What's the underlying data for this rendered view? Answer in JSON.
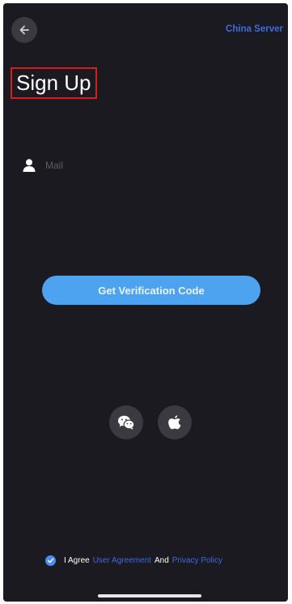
{
  "header": {
    "back_icon": "arrow-left-icon",
    "server_link": "China Server"
  },
  "title": "Sign Up",
  "mail_field": {
    "icon": "user-icon",
    "placeholder": "Mail",
    "value": ""
  },
  "verify_button": {
    "label": "Get Verification Code"
  },
  "social_login": {
    "wechat_icon": "wechat-icon",
    "apple_icon": "apple-icon"
  },
  "agreement": {
    "checked": true,
    "prefix": "I Agree",
    "user_agreement": "User Agreement",
    "conjunction": "And",
    "privacy_policy": "Privacy Policy"
  },
  "colors": {
    "background": "#1b1a20",
    "accent_blue": "#4ea3f1",
    "link_blue": "#3d6cdc",
    "highlight_box": "#d21f1f"
  }
}
